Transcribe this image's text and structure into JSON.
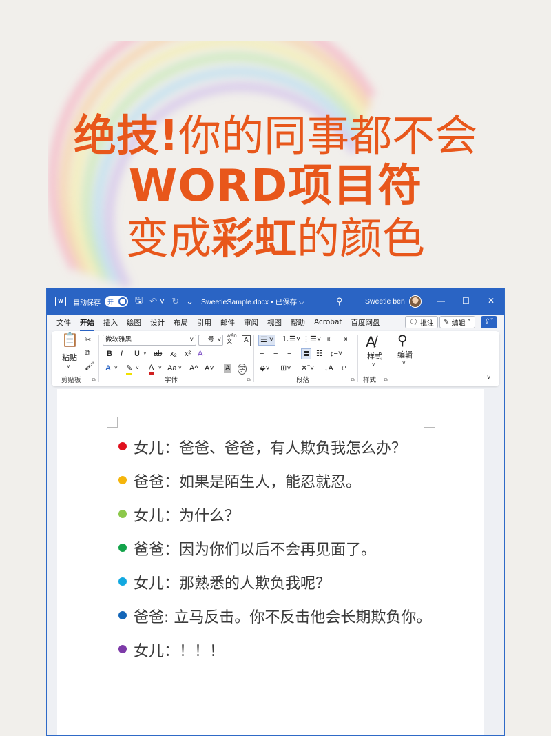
{
  "headline": {
    "line1_strong": "绝技!",
    "line1_rest": "你的同事都不会",
    "line2": "WORD项目符",
    "line3_a": "变成",
    "line3_strong": "彩虹",
    "line3_b": "的颜色"
  },
  "colors": {
    "accent": "#e8571b",
    "titlebar": "#2a64c4",
    "bullet_colors": [
      "#e0101d",
      "#f5b50b",
      "#8cc84b",
      "#13a34a",
      "#11a8e0",
      "#1466b8",
      "#7d3aa8"
    ]
  },
  "titlebar": {
    "app_icon": "word-icon",
    "autosave_label": "自动保存",
    "toggle_label": "开",
    "doc_title": "SweetieSample.docx • 已保存 ⌵",
    "user_name": "Sweetie ben",
    "minimize": "—",
    "maximize": "☐",
    "close": "✕"
  },
  "menubar": {
    "items": [
      "文件",
      "开始",
      "插入",
      "绘图",
      "设计",
      "布局",
      "引用",
      "邮件",
      "审阅",
      "视图",
      "帮助",
      "Acrobat",
      "百度网盘"
    ],
    "active": "开始",
    "comments_label": "批注",
    "edit_label": "编辑"
  },
  "ribbon": {
    "clipboard": {
      "paste_label": "粘贴",
      "group_label": "剪贴板"
    },
    "font": {
      "font_name": "微软雅黑",
      "font_size": "二号",
      "wen_label": "wén 文",
      "group_label": "字体",
      "bold": "B",
      "italic": "I",
      "underline": "U",
      "strike": "ab",
      "subscript": "x₂",
      "superscript": "x²",
      "grow": "A^",
      "shrink": "A˅",
      "case": "Aa",
      "clear_format": "A",
      "char_border": "A",
      "phonetic": "字"
    },
    "paragraph": {
      "group_label": "段落"
    },
    "styles": {
      "label": "样式",
      "group_label": "样式"
    },
    "editing": {
      "label": "编辑"
    }
  },
  "document": {
    "lines": [
      "女儿：爸爸、爸爸，有人欺负我怎么办？",
      "爸爸：如果是陌生人，能忍就忍。",
      "女儿：为什么？",
      "爸爸：因为你们以后不会再见面了。",
      "女儿：那熟悉的人欺负我呢？",
      "爸爸: 立马反击。你不反击他会长期欺负你。",
      "女儿：！！！"
    ]
  }
}
